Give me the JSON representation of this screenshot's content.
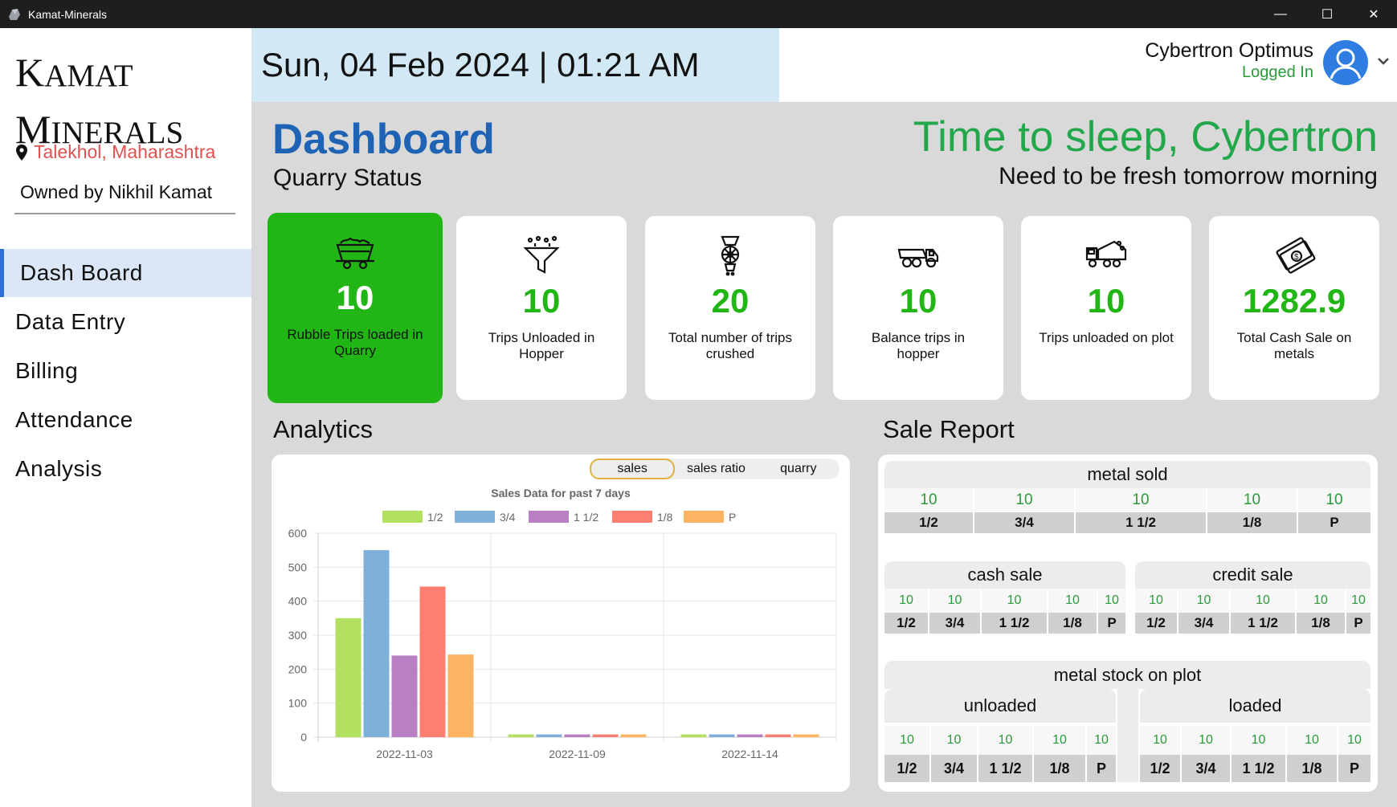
{
  "window": {
    "title": "Kamat-Minerals",
    "minimize": "—",
    "maximize": "☐",
    "close": "✕"
  },
  "brand": {
    "line1_first": "K",
    "line1_rest": "AMAT",
    "line2_first": "M",
    "line2_rest": "INERALS",
    "location": "Talekhol, Maharashtra",
    "owner": "Owned by Nikhil Kamat"
  },
  "nav": [
    {
      "label": "Dash Board",
      "active": true
    },
    {
      "label": "Data Entry"
    },
    {
      "label": "Billing"
    },
    {
      "label": "Attendance"
    },
    {
      "label": "Analysis"
    }
  ],
  "header": {
    "datetime": "Sun, 04 Feb 2024 | 01:21 AM",
    "user_name": "Cybertron Optimus",
    "user_status": "Logged In"
  },
  "main": {
    "title": "Dashboard",
    "subtitle": "Quarry Status",
    "greeting": "Time to sleep, Cybertron",
    "greeting_sub": "Need to be fresh tomorrow morning"
  },
  "cards": [
    {
      "value": "10",
      "label": "Rubble Trips loaded in Quarry",
      "icon": "mine-cart-icon"
    },
    {
      "value": "10",
      "label": "Trips Unloaded in Hopper",
      "icon": "hopper-funnel-icon"
    },
    {
      "value": "20",
      "label": "Total number of trips crushed",
      "icon": "crusher-icon"
    },
    {
      "value": "10",
      "label": "Balance trips in hopper",
      "icon": "dump-truck-icon"
    },
    {
      "value": "10",
      "label": "Trips unloaded on plot",
      "icon": "tipper-truck-icon"
    },
    {
      "value": "1282.9",
      "label": "Total Cash Sale on metals",
      "icon": "cash-icon"
    }
  ],
  "analytics": {
    "heading": "Analytics",
    "tabs": [
      "sales",
      "sales ratio",
      "quarry"
    ],
    "active_tab": "sales"
  },
  "chart_data": {
    "type": "bar",
    "title": "Sales Data for past 7 days",
    "categories": [
      "2022-11-03",
      "2022-11-09",
      "2022-11-14"
    ],
    "series": [
      {
        "name": "1/2",
        "color": "#b3e060",
        "values": [
          350,
          8,
          8
        ]
      },
      {
        "name": "3/4",
        "color": "#7eb0d9",
        "values": [
          550,
          8,
          8
        ]
      },
      {
        "name": "1 1/2",
        "color": "#b87fc2",
        "values": [
          240,
          8,
          8
        ]
      },
      {
        "name": "1/8",
        "color": "#fc7f72",
        "values": [
          443,
          8,
          8
        ]
      },
      {
        "name": "P",
        "color": "#fdb462",
        "values": [
          243,
          8,
          8
        ]
      }
    ],
    "ylim": [
      0,
      600
    ],
    "yticks": [
      "0",
      "100",
      "200",
      "300",
      "400",
      "500",
      "600"
    ],
    "legend": "top",
    "grid": true
  },
  "sale_report": {
    "heading": "Sale Report",
    "metal_sold": {
      "title": "metal sold",
      "keys": [
        "1/2",
        "3/4",
        "1 1/2",
        "1/8",
        "P"
      ],
      "values": [
        "10",
        "10",
        "10",
        "10",
        "10"
      ]
    },
    "cash_sale": {
      "title": "cash sale",
      "keys": [
        "1/2",
        "3/4",
        "1 1/2",
        "1/8",
        "P"
      ],
      "values": [
        "10",
        "10",
        "10",
        "10",
        "10"
      ]
    },
    "credit_sale": {
      "title": "credit sale",
      "keys": [
        "1/2",
        "3/4",
        "1 1/2",
        "1/8",
        "P"
      ],
      "values": [
        "10",
        "10",
        "10",
        "10",
        "10"
      ]
    },
    "stock": {
      "title": "metal stock on plot",
      "unloaded": {
        "title": "unloaded",
        "keys": [
          "1/2",
          "3/4",
          "1 1/2",
          "1/8",
          "P"
        ],
        "values": [
          "10",
          "10",
          "10",
          "10",
          "10"
        ]
      },
      "loaded": {
        "title": "loaded",
        "keys": [
          "1/2",
          "3/4",
          "1 1/2",
          "1/8",
          "P"
        ],
        "values": [
          "10",
          "10",
          "10",
          "10",
          "10"
        ]
      }
    }
  }
}
